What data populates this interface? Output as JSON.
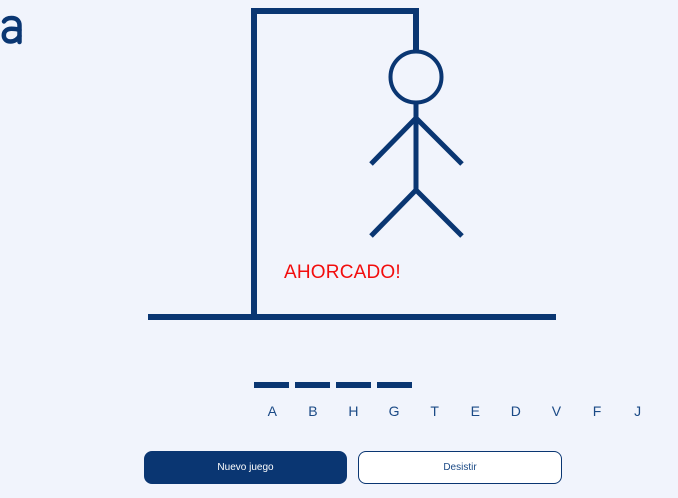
{
  "colors": {
    "primary": "#0a3672",
    "status_red": "#f20d0d",
    "background": "#f1f4fc",
    "letter_used": "#1b4a86"
  },
  "logo": {
    "icon": "brand-a-logo"
  },
  "game": {
    "status": "AHORCADO!",
    "word_length": 4,
    "revealed_letters": [
      "",
      "",
      "",
      ""
    ],
    "attempted_letters": [
      "A",
      "B",
      "H",
      "G",
      "T",
      "E",
      "D",
      "V",
      "F",
      "J"
    ]
  },
  "buttons": {
    "new_game": "Nuevo juego",
    "give_up": "Desistir"
  }
}
